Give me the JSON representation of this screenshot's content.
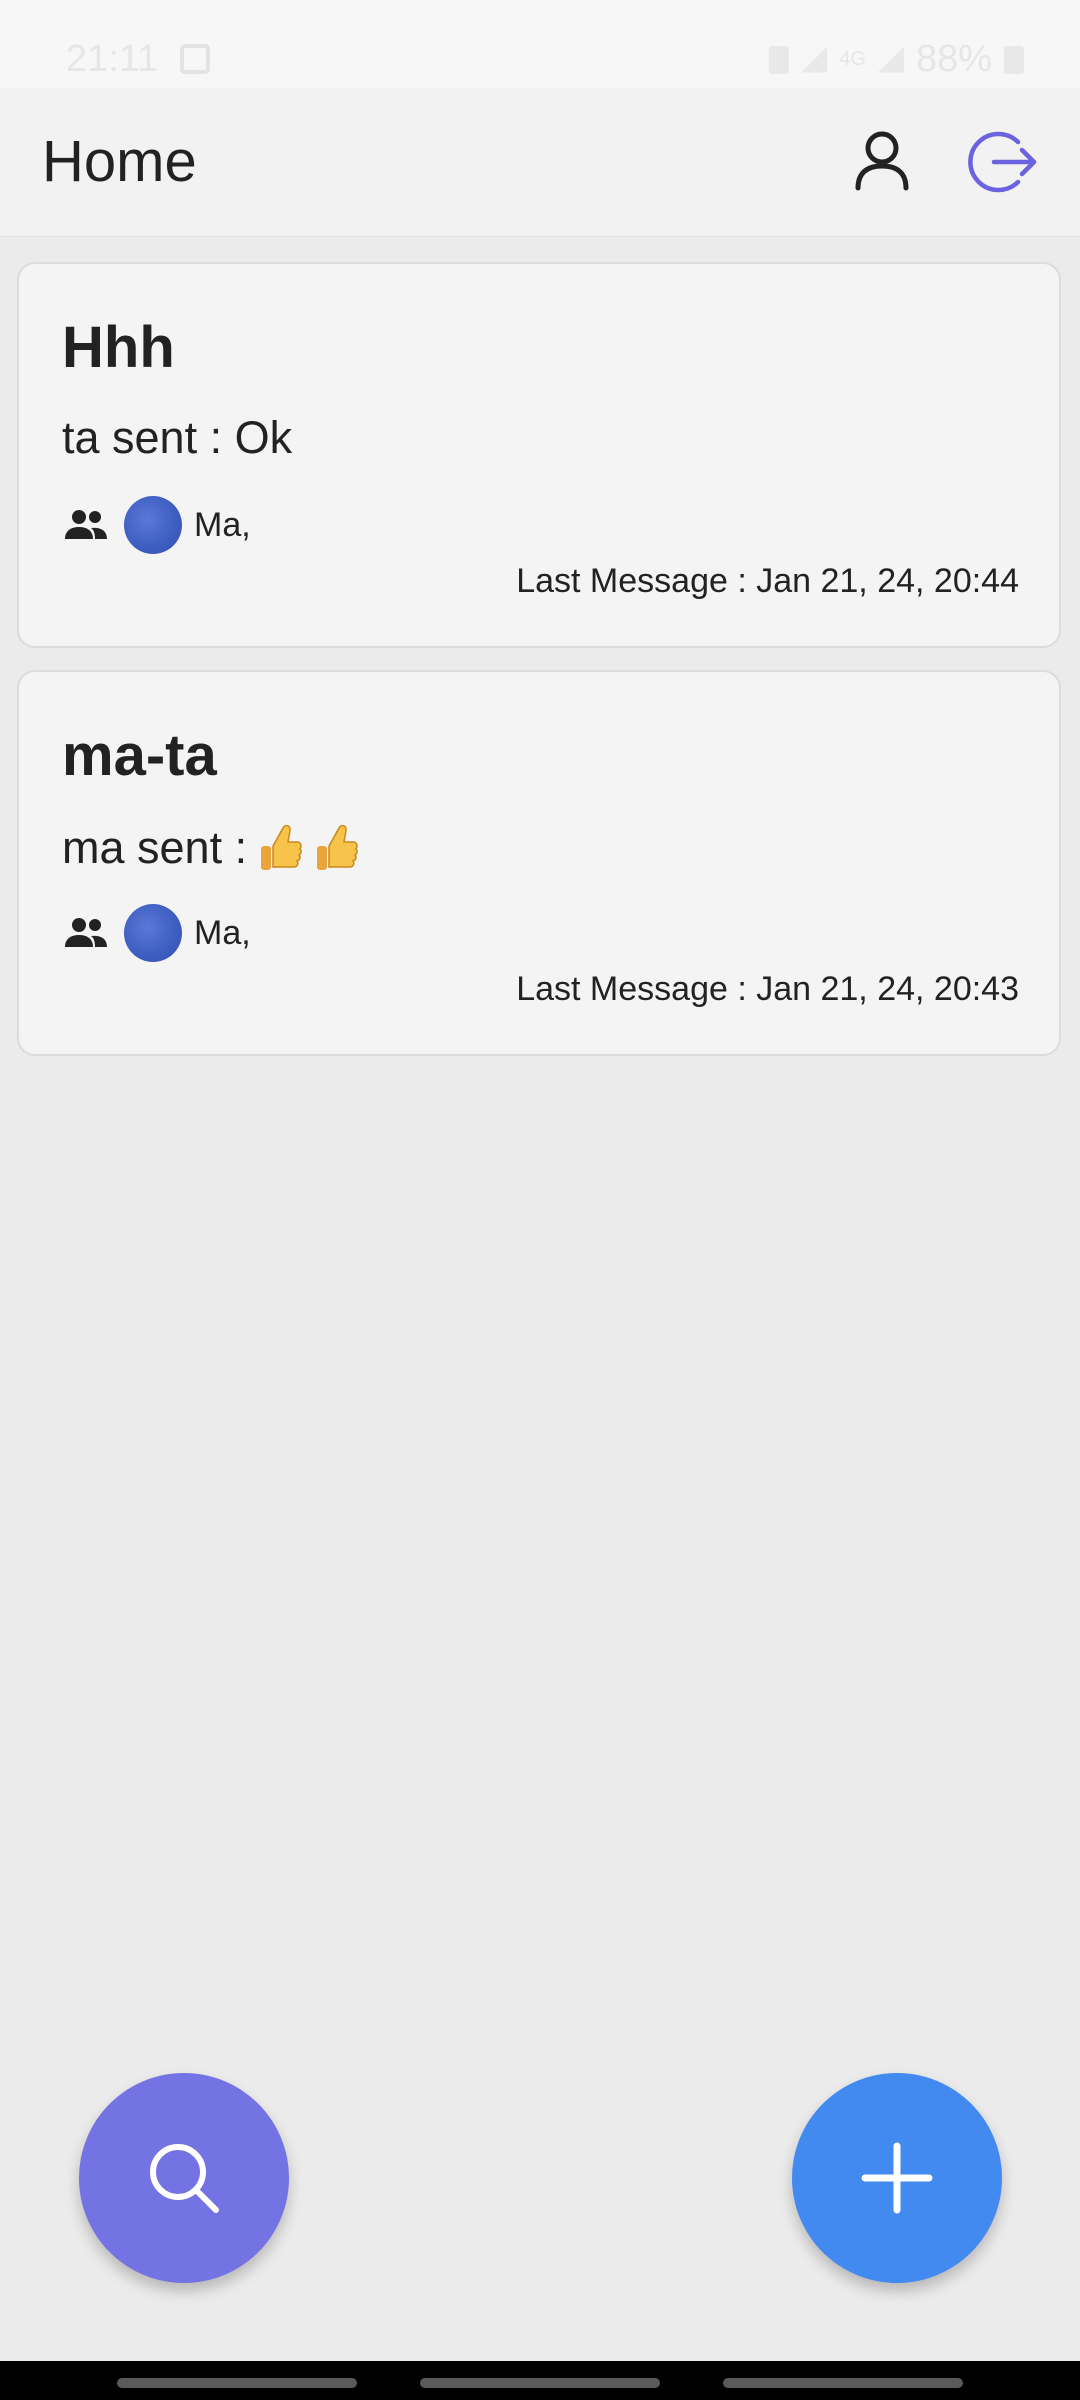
{
  "status_bar": {
    "time": "21:11",
    "battery": "88%",
    "network": "4G"
  },
  "header": {
    "title": "Home",
    "profile_icon": "person-outline-icon",
    "logout_icon": "logout-icon",
    "logout_color": "#6b62e0"
  },
  "chats": [
    {
      "title": "Hhh",
      "last_sender_text": "ta sent : Ok",
      "emoji_count": 0,
      "members": "Ma,",
      "last_message": "Last Message : Jan 21, 24, 20:44"
    },
    {
      "title": "ma-ta",
      "last_sender_text": "ma sent :",
      "emoji_count": 2,
      "emoji": "thumbs-up",
      "members": "Ma,",
      "last_message": "Last Message : Jan 21, 24, 20:43"
    }
  ],
  "fabs": {
    "search_icon": "search-icon",
    "search_color": "#7473e3",
    "add_icon": "plus-icon",
    "add_color": "#4289f0"
  }
}
